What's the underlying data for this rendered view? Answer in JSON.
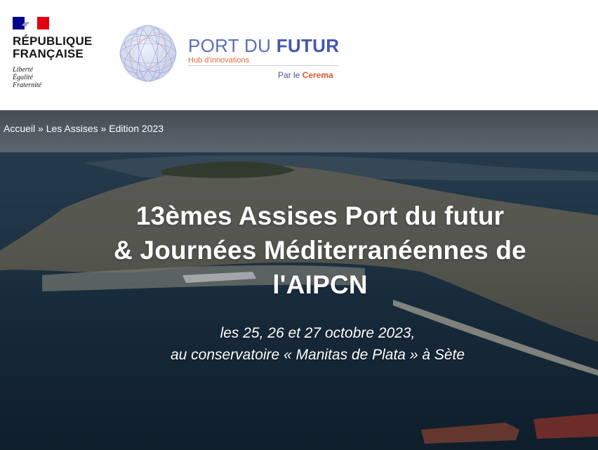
{
  "header": {
    "rf_name_line1": "RÉPUBLIQUE",
    "rf_name_line2": "FRANÇAISE",
    "rf_motto_1": "Liberté",
    "rf_motto_2": "Égalité",
    "rf_motto_3": "Fraternité",
    "logo_title_part1": "PORT DU ",
    "logo_title_part2": "FUTUR",
    "logo_subtitle": "Hub d'innovations",
    "logo_by_prefix": "Par le ",
    "logo_by_name": "Cerema"
  },
  "breadcrumb": {
    "items": [
      "Accueil",
      "Les Assises",
      "Edition 2023"
    ],
    "separator": " » "
  },
  "hero": {
    "title_line1": "13èmes Assises Port du futur",
    "title_line2": "& Journées Méditerranéennes de",
    "title_line3": "l'AIPCN",
    "subtitle_line1": "les 25, 26 et 27 octobre 2023,",
    "subtitle_line2": "au conservatoire « Manitas de Plata » à Sète"
  },
  "colors": {
    "rf_blue": "#000091",
    "rf_red": "#e1000f",
    "logo_blue": "#4457b3",
    "logo_orange": "#e36b3c",
    "hero_text": "#ffffff"
  },
  "icons": {
    "marianne": "marianne-flag-icon",
    "globe": "globe-logo-icon"
  }
}
